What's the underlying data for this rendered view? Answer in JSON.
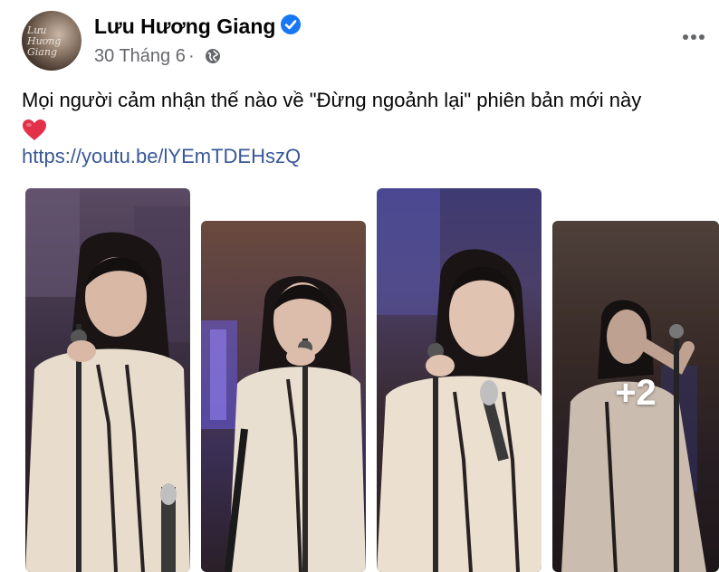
{
  "post": {
    "author": "Lưu Hương Giang",
    "avatar_text": "Lưu Hương Giang",
    "date": "30 Tháng 6",
    "separator": "·",
    "text": "Mọi người cảm nhận thế nào về \"Đừng ngoảnh lại\" phiên bản mới này",
    "link": "https://youtu.be/lYEmTDEHszQ",
    "more_photos_label": "+2"
  },
  "icons": {
    "verified": "verified-badge-icon",
    "privacy": "globe-icon",
    "emoji": "red-heart-icon",
    "menu": "more-options-icon"
  },
  "colors": {
    "accent": "#1877f2",
    "link": "#385898",
    "secondary_text": "#65676b",
    "heart": "#e4314a"
  }
}
